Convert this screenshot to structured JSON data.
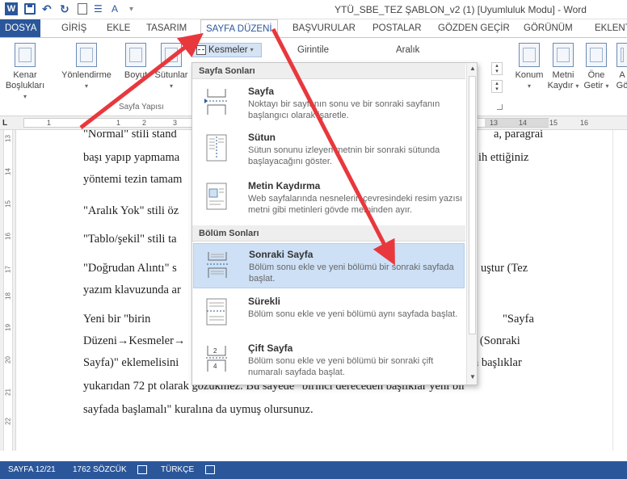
{
  "window": {
    "title": "YTÜ_SBE_TEZ ŞABLON_v2 (1) [Uyumluluk Modu] - Word",
    "word_logo": "W"
  },
  "tabs": [
    {
      "label": "DOSYA"
    },
    {
      "label": "GİRİŞ"
    },
    {
      "label": "EKLE"
    },
    {
      "label": "TASARIM"
    },
    {
      "label": "SAYFA DÜZENİ"
    },
    {
      "label": "BAŞVURULAR"
    },
    {
      "label": "POSTALAR"
    },
    {
      "label": "GÖZDEN GEÇİR"
    },
    {
      "label": "GÖRÜNÜM"
    },
    {
      "label": "EKLENTİL"
    }
  ],
  "ribbon": {
    "kenar_line1": "Kenar",
    "kenar_line2": "Boşlukları",
    "yonlendirme": "Yönlendirme",
    "boyut": "Boyut",
    "sutunlar": "Sütunlar",
    "group_sayfa_yapisi": "Sayfa Yapısı",
    "kesmeler": "Kesmeler",
    "girintile": "Girintile",
    "aralik": "Aralık",
    "konum": "Konum",
    "metni_line1": "Metni",
    "metni_line2": "Kaydır",
    "one_line1": "Öne",
    "one_line2": "Getir",
    "a_line1": "A",
    "a_line2": "Gö"
  },
  "ruler": {
    "corner": "L",
    "numbers": [
      "1",
      "1",
      "2",
      "3",
      "13",
      "14",
      "15",
      "16"
    ]
  },
  "vruler": {
    "numbers": [
      "13",
      "14",
      "15",
      "16",
      "17",
      "18",
      "19",
      "20",
      "21",
      "22"
    ]
  },
  "document": {
    "lines": [
      "\"Normal\" stili stand",
      "başı yapıp yapmama",
      "yöntemi tezin tamam",
      "\"Aralık Yok\" stili öz",
      "\"Tablo/şekil\" stili ta",
      "\"Doğrudan Alıntı\" s",
      "yazım klavuzunda ar",
      "Yeni       bir       \"birin",
      "Düzeni→Kesmeler→",
      "Sayfa)\" eklemelisini",
      "yukarıdan 72 pt olarak gözükmez. Bu sayede \"birinci dereceden başlıklar yeni bir",
      "sayfada başlamalı\" kuralına da uymuş olursunuz."
    ],
    "right_fragments": [
      "a, paragrai",
      "ih ettiğiniz",
      "uştur (Tez",
      "\"Sayfa",
      "u (Sonraki",
      "n başlıklar"
    ]
  },
  "menu": {
    "section1": "Sayfa Sonları",
    "section2": "Bölüm Sonları",
    "items": [
      {
        "title": "Sayfa",
        "desc": "Noktayı bir sayfanın sonu ve bir sonraki sayfanın başlangıcı olarak işaretle."
      },
      {
        "title": "Sütun",
        "desc": "Sütun sonunu izleyen metnin bir sonraki sütunda başlayacağını göster."
      },
      {
        "title": "Metin Kaydırma",
        "desc": "Web sayfalarında nesnelerin çevresindeki resim yazısı metni gibi metinleri gövde metninden ayır."
      },
      {
        "title": "Sonraki Sayfa",
        "desc": "Bölüm sonu ekle ve yeni bölümü bir sonraki sayfada başlat."
      },
      {
        "title": "Sürekli",
        "desc": "Bölüm sonu ekle ve yeni bölümü aynı sayfada başlat."
      },
      {
        "title": "Çift Sayfa",
        "desc": "Bölüm sonu ekle ve yeni bölümü bir sonraki çift numaralı sayfada başlat."
      }
    ],
    "cift_icon_num": "2",
    "cift_icon_num2": "4"
  },
  "statusbar": {
    "page": "SAYFA 12/21",
    "words": "1762 SÖZCÜK",
    "language": "TÜRKÇE"
  },
  "colors": {
    "accent": "#2b579a",
    "annotation_arrow": "#e8383d",
    "hover": "#cde0f5"
  }
}
